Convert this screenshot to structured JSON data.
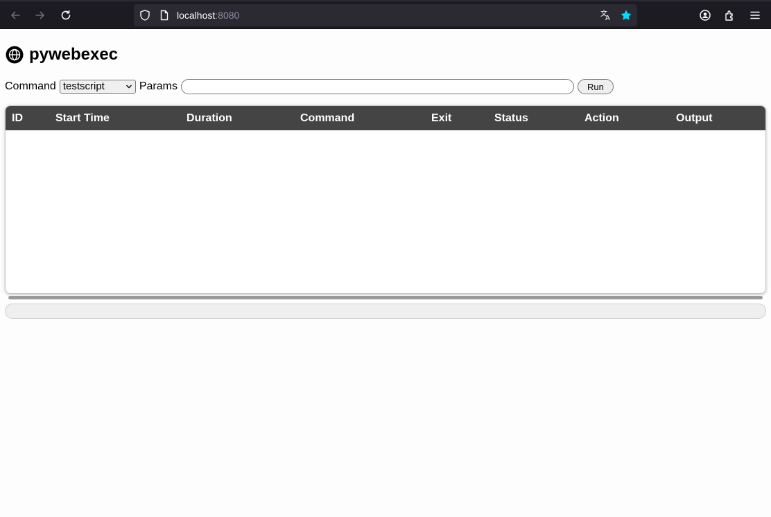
{
  "browser": {
    "url_host": "localhost",
    "url_port": ":8080",
    "icons": [
      "back-icon",
      "forward-icon",
      "reload-icon",
      "shield-icon",
      "page-icon",
      "translate-icon",
      "bookmark-star-icon",
      "account-icon",
      "extensions-icon",
      "menu-icon"
    ],
    "star_color": "#00ddff"
  },
  "app": {
    "title": "pywebexec",
    "icon": "globe-icon"
  },
  "form": {
    "command_label": "Command",
    "command_selected": "testscript",
    "params_label": "Params",
    "params_value": "",
    "run_label": "Run"
  },
  "table": {
    "header_bg": "#444444",
    "columns": [
      "ID",
      "Start Time",
      "Duration",
      "Command",
      "Exit",
      "Status",
      "Action",
      "Output"
    ],
    "rows": []
  }
}
